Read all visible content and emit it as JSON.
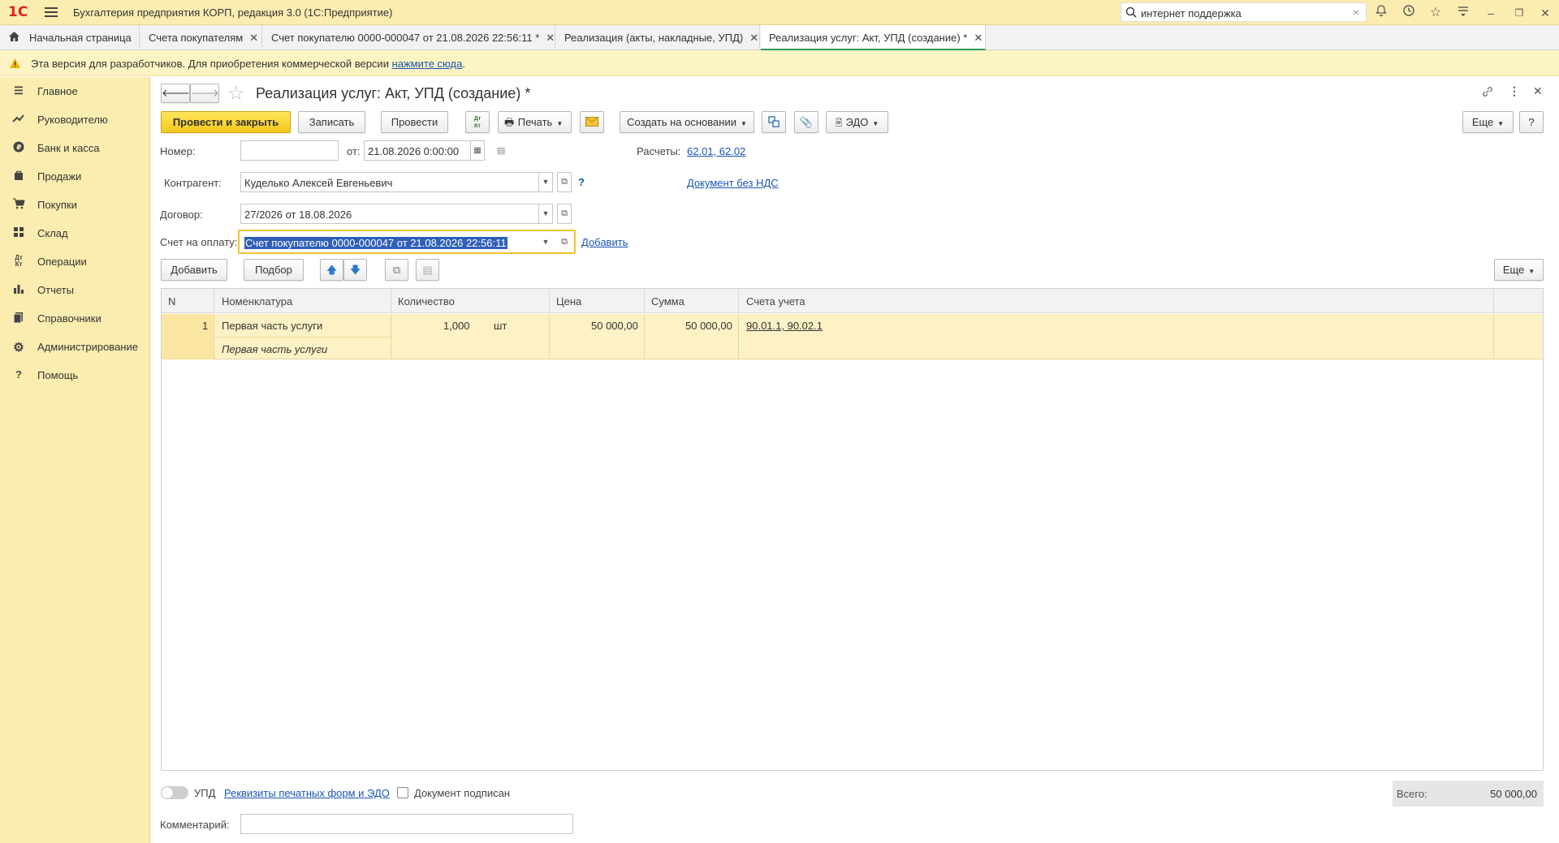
{
  "app": {
    "logo": "1С",
    "title": "Бухгалтерия предприятия КОРП, редакция 3.0  (1С:Предприятие)"
  },
  "search": {
    "value": "интернет поддержка"
  },
  "tabs": [
    {
      "label": "Начальная страница"
    },
    {
      "label": "Счета покупателям"
    },
    {
      "label": "Счет покупателю 0000-000047 от 21.08.2026 22:56:11 *"
    },
    {
      "label": "Реализация (акты, накладные, УПД)"
    },
    {
      "label": "Реализация услуг: Акт, УПД (создание) *"
    }
  ],
  "warning": {
    "text": "Эта версия для разработчиков. Для приобретения коммерческой версии ",
    "link": "нажмите сюда",
    "tail": "."
  },
  "sidebar": {
    "items": [
      {
        "label": "Главное",
        "icon": "menu-icon"
      },
      {
        "label": "Руководителю",
        "icon": "trend-icon"
      },
      {
        "label": "Банк и касса",
        "icon": "ruble-icon"
      },
      {
        "label": "Продажи",
        "icon": "bag-icon"
      },
      {
        "label": "Покупки",
        "icon": "cart-icon"
      },
      {
        "label": "Склад",
        "icon": "warehouse-icon"
      },
      {
        "label": "Операции",
        "icon": "dt-kt-icon"
      },
      {
        "label": "Отчеты",
        "icon": "bar-chart-icon"
      },
      {
        "label": "Справочники",
        "icon": "books-icon"
      },
      {
        "label": "Администрирование",
        "icon": "gear-icon"
      },
      {
        "label": "Помощь",
        "icon": "help-icon"
      }
    ]
  },
  "form": {
    "title": "Реализация услуг: Акт, УПД (создание) *",
    "toolbar": {
      "post_close": "Провести и закрыть",
      "save": "Записать",
      "post": "Провести",
      "print": "Печать",
      "create_based": "Создать на основании",
      "edo": "ЭДО",
      "more": "Еще",
      "help": "?"
    },
    "number_label": "Номер:",
    "number_value": "",
    "from_label": "от:",
    "date_value": "21.08.2026  0:00:00",
    "settlements_label": "Расчеты:",
    "settlements_link": "62.01, 62.02",
    "counterparty_label": "Контрагент:",
    "counterparty_value": "Куделько Алексей Евгеньевич",
    "no_vat_link": "Документ без НДС",
    "contract_label": "Договор:",
    "contract_value": "27/2026 от 18.08.2026",
    "invoice_label": "Счет на оплату:",
    "invoice_value": "Счет покупателю 0000-000047 от 21.08.2026 22:56:11",
    "add_link": "Добавить",
    "q_mark": "?"
  },
  "table_toolbar": {
    "add": "Добавить",
    "pick": "Подбор",
    "more": "Еще"
  },
  "table": {
    "columns": [
      "N",
      "Номенклатура",
      "Количество",
      "Цена",
      "Сумма",
      "Счета учета"
    ],
    "rows": [
      {
        "n": "1",
        "name": "Первая часть услуги",
        "content": "Первая часть услуги",
        "qty": "1,000",
        "unit": "шт",
        "price": "50 000,00",
        "sum": "50 000,00",
        "accounts": "90.01.1, 90.02.1"
      }
    ]
  },
  "footer": {
    "upd_label": "УПД",
    "requisites_link": "Реквизиты печатных форм и ЭДО",
    "signed_label": "Документ подписан",
    "total_label": "Всего:",
    "total_value": "50 000,00",
    "comment_label": "Комментарий:",
    "comment_value": ""
  }
}
